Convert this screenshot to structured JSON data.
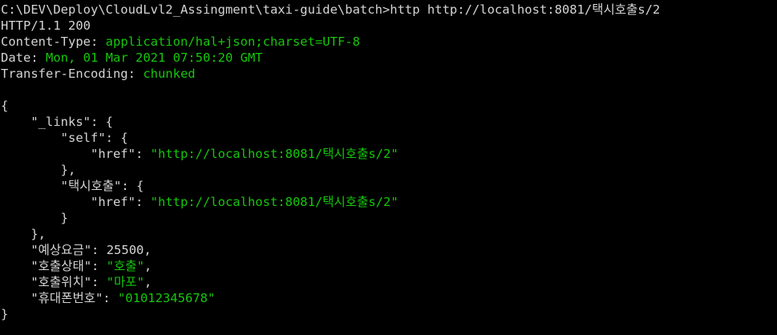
{
  "terminal": {
    "prompt": "C:\\DEV\\Deploy\\CloudLvl2_Assingment\\taxi-guide\\batch>",
    "command": "http http://localhost:8081/택시호출s/2",
    "status_line": "HTTP/1.1 200",
    "headers": [
      {
        "name": "Content-Type",
        "sep": ": ",
        "value": "application/hal+json;charset=UTF-8"
      },
      {
        "name": "Date",
        "sep": ": ",
        "value": "Mon, 01 Mar 2021 07:50:20 GMT"
      },
      {
        "name": "Transfer-Encoding",
        "sep": ": ",
        "value": "chunked"
      }
    ],
    "body": {
      "open_brace": "{",
      "links_key": "\"_links\"",
      "self_key": "\"self\"",
      "href_key": "\"href\"",
      "self_href": "\"http://localhost:8081/택시호출s/2\"",
      "taxi_key": "\"택시호출\"",
      "taxi_href": "\"http://localhost:8081/택시호출s/2\"",
      "fare_key": "\"예상요금\"",
      "fare_value": "25500",
      "status_key": "\"호출상태\"",
      "status_value": "\"호출\"",
      "location_key": "\"호출위치\"",
      "location_value": "\"마포\"",
      "phone_key": "\"휴대폰번호\"",
      "phone_value": "\"01012345678\"",
      "close_brace": "}"
    }
  },
  "colors": {
    "background": "#000000",
    "text": "#d4d4d4",
    "accent_green": "#16c60c"
  }
}
